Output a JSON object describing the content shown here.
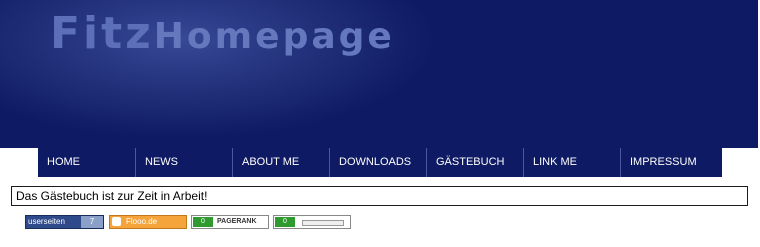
{
  "header": {
    "logo_part1": "Fitz",
    "logo_part2": "Homepage"
  },
  "nav": [
    {
      "label": "HOME"
    },
    {
      "label": "NEWS"
    },
    {
      "label": "ABOUT ME"
    },
    {
      "label": "DOWNLOADS"
    },
    {
      "label": "GÄSTEBUCH"
    },
    {
      "label": "LINK ME"
    },
    {
      "label": "IMPRESSUM"
    }
  ],
  "message": "Das Gästebuch ist zur Zeit in Arbeit!",
  "badges": {
    "userseiten_label": "userseiten",
    "userseiten_count": "7",
    "flooo_label": "Flooo.de",
    "pagerank_value": "0",
    "pagerank_label": "PAGERANK",
    "rank2_value": "0",
    "rank2_level": 0
  },
  "colors": {
    "header_bg": "#0e1a63",
    "logo": "#5c6fb8"
  }
}
